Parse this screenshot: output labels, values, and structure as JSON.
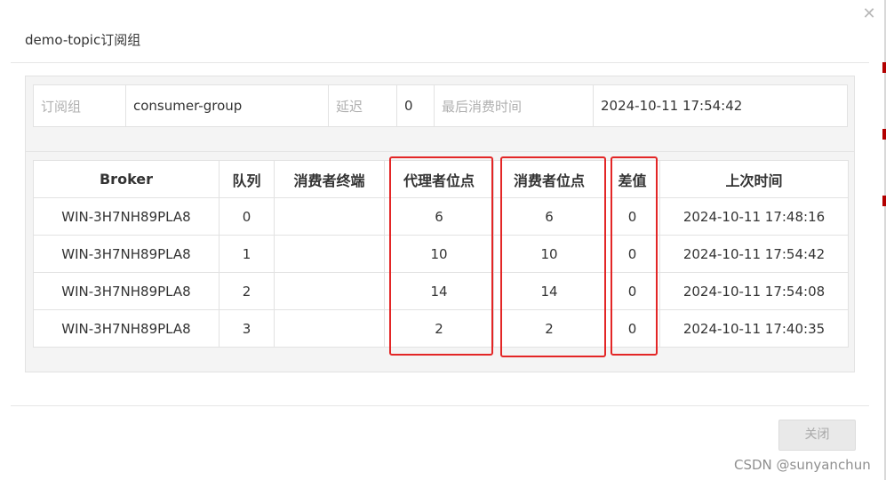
{
  "dialog": {
    "title": "demo-topic订阅组",
    "close_icon": "close-icon",
    "close_button_label": "关闭"
  },
  "info": {
    "group_label": "订阅组",
    "group_value": "consumer-group",
    "delay_label": "延迟",
    "delay_value": "0",
    "last_consume_label": "最后消费时间",
    "last_consume_value": "2024-10-11 17:54:42"
  },
  "table": {
    "headers": [
      "Broker",
      "队列",
      "消费者终端",
      "代理者位点",
      "消费者位点",
      "差值",
      "上次时间"
    ],
    "rows": [
      {
        "broker": "WIN-3H7NH89PLA8",
        "queue": "0",
        "client": "",
        "broker_offset": "6",
        "consumer_offset": "6",
        "diff": "0",
        "last_time": "2024-10-11 17:48:16"
      },
      {
        "broker": "WIN-3H7NH89PLA8",
        "queue": "1",
        "client": "",
        "broker_offset": "10",
        "consumer_offset": "10",
        "diff": "0",
        "last_time": "2024-10-11 17:54:42"
      },
      {
        "broker": "WIN-3H7NH89PLA8",
        "queue": "2",
        "client": "",
        "broker_offset": "14",
        "consumer_offset": "14",
        "diff": "0",
        "last_time": "2024-10-11 17:54:08"
      },
      {
        "broker": "WIN-3H7NH89PLA8",
        "queue": "3",
        "client": "",
        "broker_offset": "2",
        "consumer_offset": "2",
        "diff": "0",
        "last_time": "2024-10-11 17:40:35"
      }
    ]
  },
  "highlight_color": "#e32626",
  "watermark": "CSDN @sunyanchun"
}
